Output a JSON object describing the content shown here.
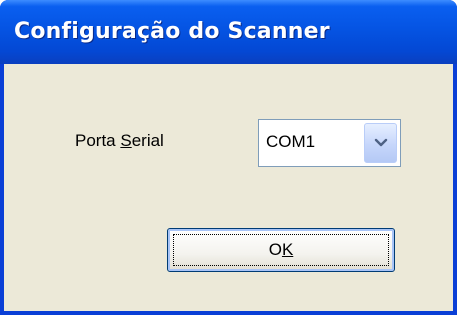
{
  "window": {
    "title": "Configuração do Scanner"
  },
  "form": {
    "serial_port_label_before": "Porta ",
    "serial_port_label_underlined": "S",
    "serial_port_label_after": "erial",
    "serial_port_value": "COM1",
    "dropdown_icon": "chevron-down-icon"
  },
  "buttons": {
    "ok_underlined": "O",
    "ok_rest": "K"
  },
  "colors": {
    "titlebar": "#0554e3",
    "client": "#ece9d8",
    "button_border": "#003c74"
  }
}
